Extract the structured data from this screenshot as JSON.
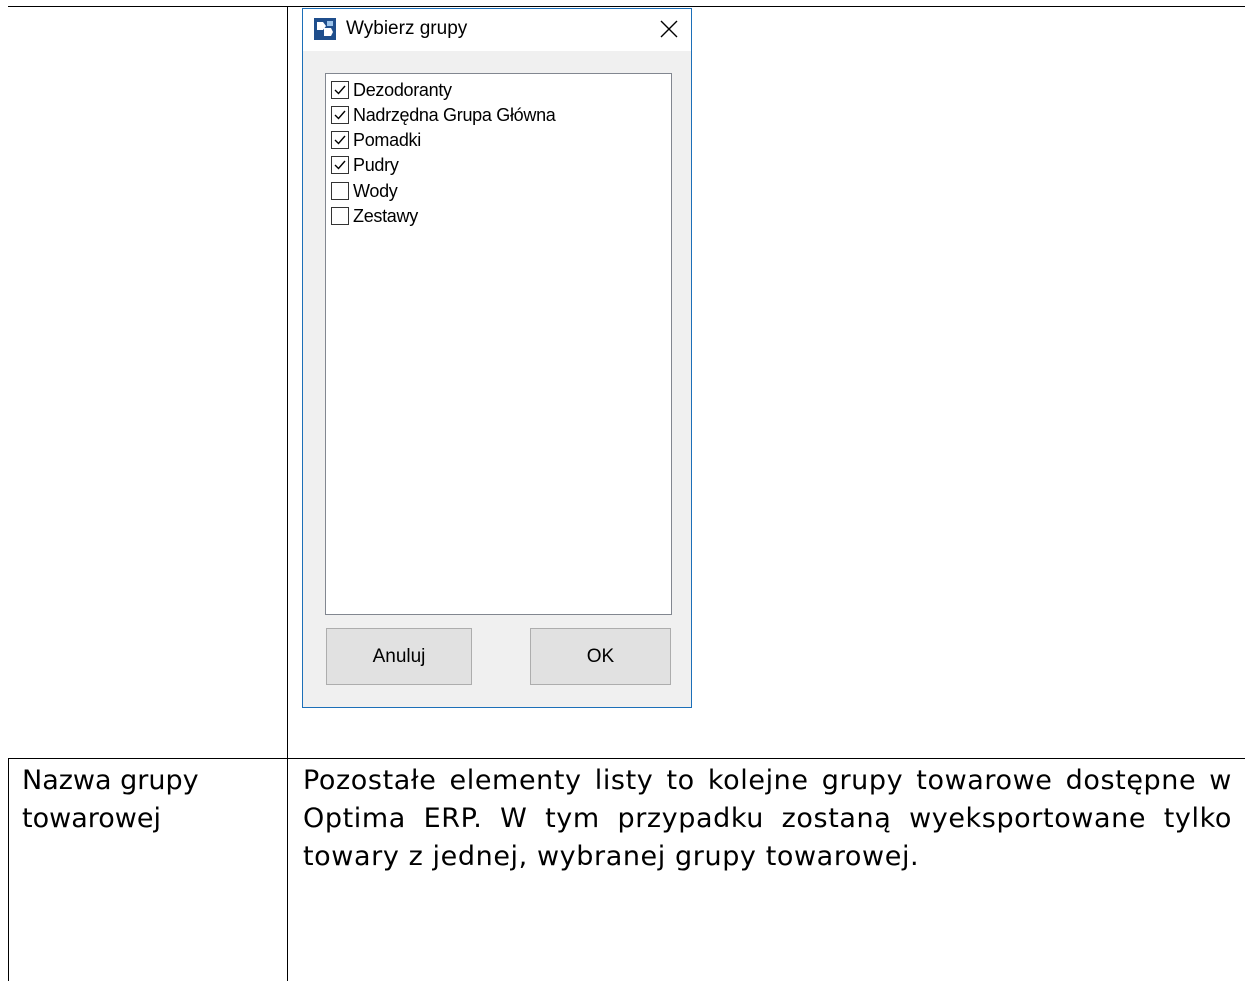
{
  "dialog": {
    "title": "Wybierz grupy",
    "icon": "app-logo-icon",
    "close_icon": "close-icon",
    "items": [
      {
        "label": "Dezodoranty",
        "checked": true
      },
      {
        "label": "Nadrzędna Grupa Główna",
        "checked": true
      },
      {
        "label": "Pomadki",
        "checked": true
      },
      {
        "label": "Pudry",
        "checked": true
      },
      {
        "label": "Wody",
        "checked": false
      },
      {
        "label": "Zestawy",
        "checked": false
      }
    ],
    "cancel_label": "Anuluj",
    "ok_label": "OK"
  },
  "table": {
    "left_cell": "Nazwa grupy towarowej",
    "right_cell": "Pozostałe elementy listy to kolejne grupy towarowe dostępne w Optima ERP. W tym przypadku zostaną wyeksportowane tylko towary z jednej, wybranej grupy towarowej."
  },
  "colors": {
    "dialog_border": "#1c6fb8",
    "dialog_bg": "#f0f0f0",
    "button_bg": "#e1e1e1"
  }
}
